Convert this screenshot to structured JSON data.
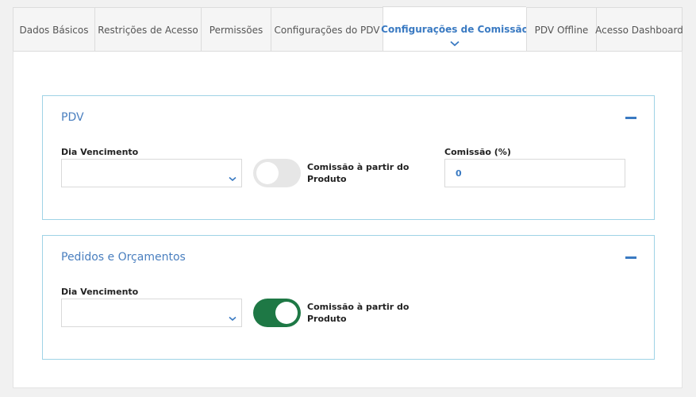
{
  "tabs": [
    {
      "label": "Dados Básicos"
    },
    {
      "label": "Restrições de Acesso"
    },
    {
      "label": "Permissões"
    },
    {
      "label": "Configurações do PDV"
    },
    {
      "label": "Configurações de Comissão"
    },
    {
      "label": "PDV Offline"
    },
    {
      "label": "Acesso Dashboard"
    }
  ],
  "active_tab_index": 4,
  "sections": {
    "pdv": {
      "title": "PDV",
      "dia_vencimento_label": "Dia Vencimento",
      "dia_vencimento_value": "",
      "toggle_label": "Comissão à partir do Produto",
      "toggle_on": false,
      "comissao_label": "Comissão (%)",
      "comissao_value": "0"
    },
    "pedidos": {
      "title": "Pedidos e Orçamentos",
      "dia_vencimento_label": "Dia Vencimento",
      "dia_vencimento_value": "",
      "toggle_label": "Comissão à partir do Produto",
      "toggle_on": true
    }
  },
  "colors": {
    "accent": "#3a7ac2",
    "toggle_on": "#1e7845",
    "toggle_off": "#e6e6e6",
    "card_border": "#9fd3e6"
  },
  "icons": {
    "tab_indicator": "chevron-down-icon",
    "select_arrow": "chevron-down-icon",
    "collapse": "minus-icon"
  }
}
